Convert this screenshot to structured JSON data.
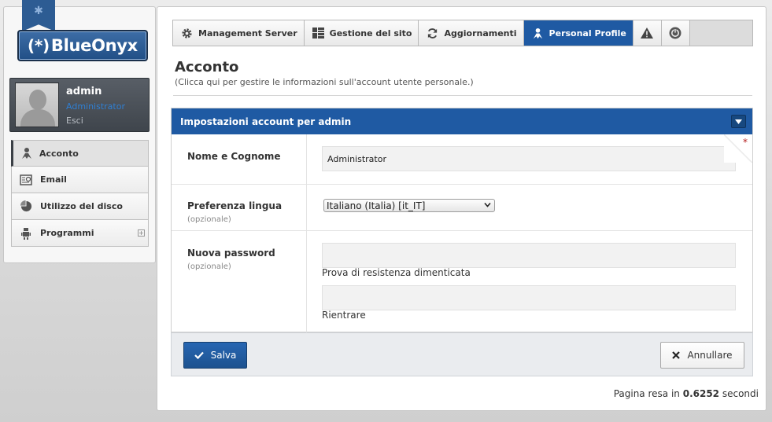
{
  "brand": {
    "logo_mark": "(*)",
    "logo_text": "BlueOnyx"
  },
  "user": {
    "name": "admin",
    "role": "Administrator",
    "logout": "Esci"
  },
  "sidebar": {
    "items": [
      {
        "label": "Acconto",
        "icon": "person-icon",
        "active": true
      },
      {
        "label": "Email",
        "icon": "email-icon"
      },
      {
        "label": "Utilizzo del disco",
        "icon": "pie-chart-icon"
      },
      {
        "label": "Programmi",
        "icon": "robot-icon",
        "expandable": true
      }
    ]
  },
  "tabs": [
    {
      "label": "Management Server",
      "icon": "gear-icon"
    },
    {
      "label": "Gestione del sito",
      "icon": "grid-icon"
    },
    {
      "label": "Aggiornamenti",
      "icon": "refresh-icon"
    },
    {
      "label": "Personal Profile",
      "icon": "person-icon",
      "active": true
    },
    {
      "label": "",
      "icon": "warning-icon"
    },
    {
      "label": "",
      "icon": "logout-icon"
    }
  ],
  "page": {
    "title": "Acconto",
    "subtitle": "(Clicca qui per gestire le informazioni sull'account utente personale.)"
  },
  "form": {
    "header": "Impostazioni account per admin",
    "fullname": {
      "label": "Nome e Cognome",
      "value": "Administrator",
      "required_mark": "*"
    },
    "language": {
      "label": "Preferenza lingua",
      "optional": "(opzionale)",
      "value": "Italiano (Italia) [it_IT]"
    },
    "password": {
      "label": "Nuova password",
      "optional": "(opzionale)",
      "strength_caption": "Prova di resistenza dimenticata",
      "repeat_caption": "Rientrare"
    }
  },
  "actions": {
    "save": "Salva",
    "cancel": "Annullare"
  },
  "footer": {
    "render_prefix": "Pagina resa in",
    "render_time": "0.6252",
    "render_suffix": "secondi"
  },
  "colors": {
    "accent": "#1f5aa3",
    "required": "#b51d1d",
    "role": "#2f7fd3"
  }
}
